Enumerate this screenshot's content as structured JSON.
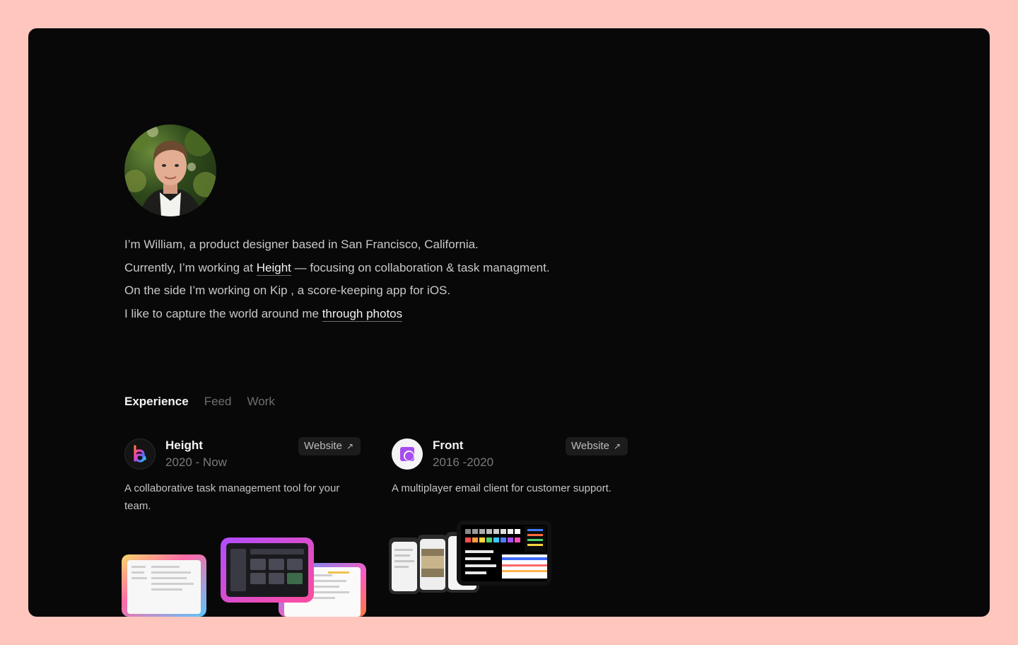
{
  "bio": {
    "line1": "I’m William, a product designer based in San Francisco, California.",
    "line2_pre": "Currently, I’m working at ",
    "line2_link": "Height",
    "line2_post": " — focusing on collaboration & task managment.",
    "line3": "On the side I’m working on Kip , a score-keeping app for iOS.",
    "line4_pre": "I like to capture the world around me ",
    "line4_link": "through photos"
  },
  "tabs": [
    {
      "label": "Experience",
      "active": true
    },
    {
      "label": "Feed",
      "active": false
    },
    {
      "label": "Work",
      "active": false
    }
  ],
  "experience": [
    {
      "company": "Height",
      "years": "2020 - Now",
      "button": "Website",
      "description": "A collaborative task management tool for your team.",
      "logo_icon": "height-logo-icon"
    },
    {
      "company": "Front",
      "years": "2016 -2020",
      "button": "Website",
      "description": "A multiplayer email client for customer support.",
      "logo_icon": "front-logo-icon"
    }
  ],
  "colors": {
    "page_bg": "#ffc6be",
    "frame_bg": "#080808",
    "front_accent": "#a64cf0"
  }
}
